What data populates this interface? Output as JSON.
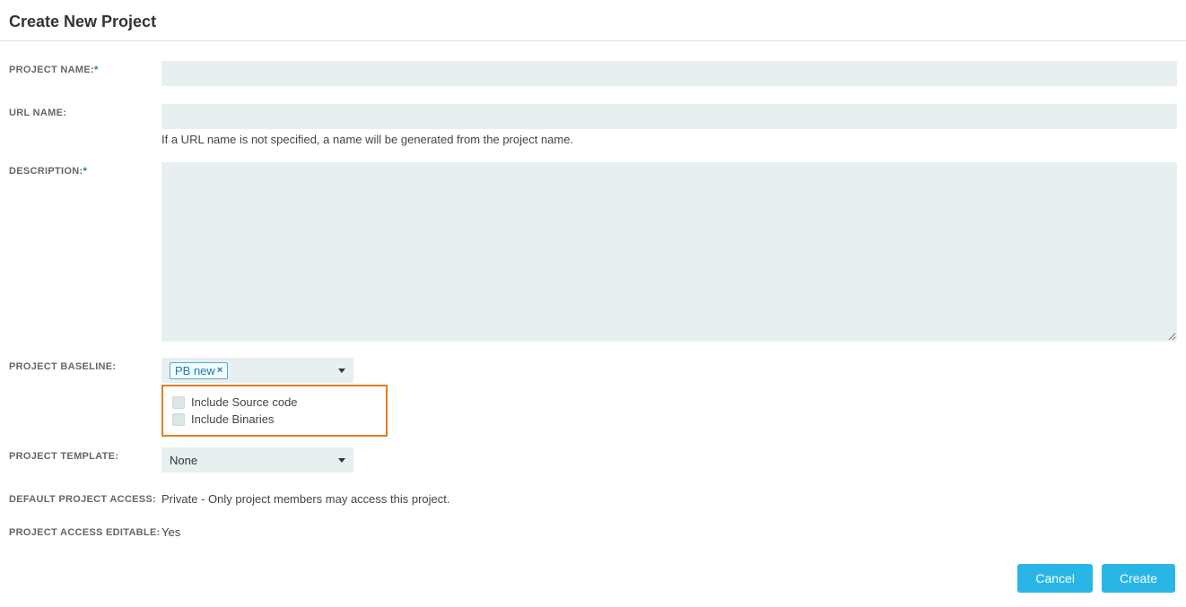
{
  "page": {
    "title": "Create New Project"
  },
  "fields": {
    "project_name": {
      "label": "PROJECT NAME:",
      "required_mark": "*",
      "value": ""
    },
    "url_name": {
      "label": "URL NAME:",
      "value": "",
      "hint": "If a URL name is not specified, a name will be generated from the project name."
    },
    "description": {
      "label": "DESCRIPTION:",
      "required_mark": "*",
      "value": ""
    },
    "project_baseline": {
      "label": "PROJECT BASELINE:",
      "token": "PB new"
    },
    "include_source_code": {
      "label": "Include Source code",
      "checked": false
    },
    "include_binaries": {
      "label": "Include Binaries",
      "checked": false
    },
    "project_template": {
      "label": "PROJECT TEMPLATE:",
      "value": "None"
    },
    "default_project_access": {
      "label": "DEFAULT PROJECT ACCESS:",
      "value": "Private - Only project members may access this project."
    },
    "project_access_editable": {
      "label": "PROJECT ACCESS EDITABLE:",
      "value": "Yes"
    }
  },
  "actions": {
    "cancel": "Cancel",
    "create": "Create"
  }
}
